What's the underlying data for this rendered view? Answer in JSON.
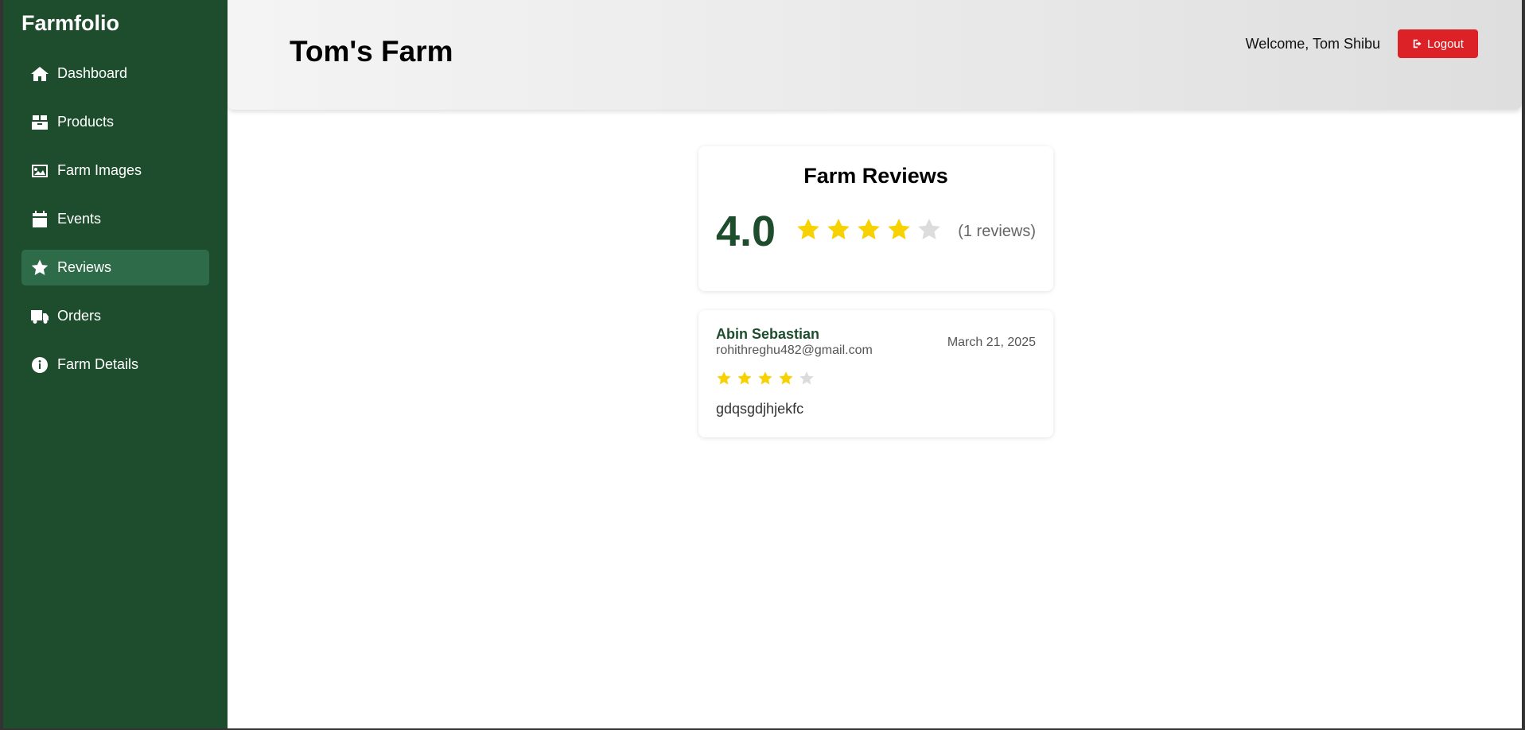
{
  "sidebar": {
    "brand": "Farmfolio",
    "items": [
      {
        "label": "Dashboard",
        "icon": "home-icon"
      },
      {
        "label": "Products",
        "icon": "box-icon"
      },
      {
        "label": "Farm Images",
        "icon": "image-icon"
      },
      {
        "label": "Events",
        "icon": "calendar-icon"
      },
      {
        "label": "Reviews",
        "icon": "star-icon",
        "active": true
      },
      {
        "label": "Orders",
        "icon": "truck-icon"
      },
      {
        "label": "Farm Details",
        "icon": "info-icon"
      }
    ]
  },
  "header": {
    "title": "Tom's Farm",
    "welcome": "Welcome, Tom Shibu",
    "logout_label": "Logout"
  },
  "summary": {
    "title": "Farm Reviews",
    "average": "4.0",
    "rating": 4,
    "max_rating": 5,
    "count_label": "(1 reviews)"
  },
  "reviews": [
    {
      "name": "Abin Sebastian",
      "email": "rohithreghu482@gmail.com",
      "date": "March 21, 2025",
      "rating": 4,
      "comment": "gdqsgdjhjekfc"
    }
  ],
  "colors": {
    "sidebar": "#1e4d2e",
    "accent": "#1e4d2e",
    "active_item": "#2e6b48",
    "logout": "#dc2127",
    "star": "#f7d200"
  }
}
